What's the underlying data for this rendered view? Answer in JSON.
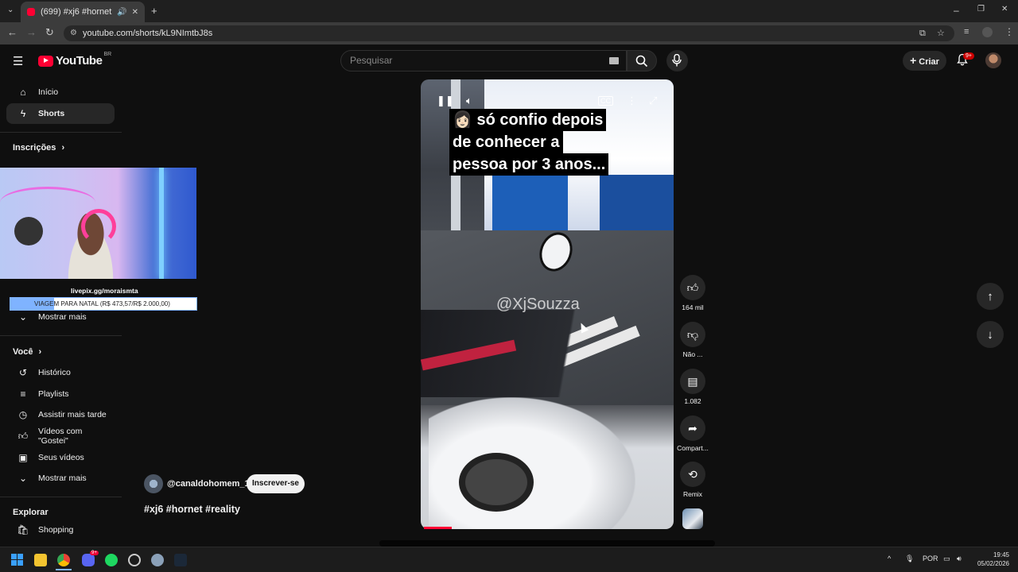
{
  "browser": {
    "tab_title": "(699) #xj6 #hornet #reality",
    "url": "youtube.com/shorts/kL9NImtbJ8s",
    "new_tab": "+",
    "minimize": "–",
    "maximize": "❐",
    "close": "✕"
  },
  "header": {
    "logo_text": "YouTube",
    "country": "BR",
    "search_placeholder": "Pesquisar",
    "create_label": "Criar",
    "notif_count": "9+"
  },
  "sidebar": {
    "main": [
      {
        "label": "Início",
        "icon": "home-icon"
      },
      {
        "label": "Shorts",
        "icon": "shorts-icon"
      }
    ],
    "subs_title": "Inscrições",
    "show_more_1": "Mostrar mais",
    "you_title": "Você",
    "you_items": [
      {
        "label": "Histórico",
        "icon": "history-icon"
      },
      {
        "label": "Playlists",
        "icon": "playlist-icon"
      },
      {
        "label": "Assistir mais tarde",
        "icon": "clock-icon"
      },
      {
        "label": "Vídeos com \"Gostei\"",
        "icon": "like-icon"
      },
      {
        "label": "Seus vídeos",
        "icon": "video-icon"
      }
    ],
    "show_more_2": "Mostrar mais",
    "explore_title": "Explorar",
    "explore_items": [
      {
        "label": "Shopping",
        "icon": "bag-icon"
      }
    ]
  },
  "overlay": {
    "livepix": "livepix.gg/moraismta",
    "goal_text": "VIAGEM PARA NATAL (R$ 473,57/R$ 2.000,00)",
    "goal_progress": 0.2368
  },
  "short": {
    "caption_lines": [
      "só confio depois",
      "de conhecer a",
      "pessoa por 3 anos..."
    ],
    "caption_emoji": "👩🏻",
    "watermark": "@XjSouzza",
    "progress": 0.11,
    "channel": "@canaldohomem_1",
    "subscribe_label": "Inscrever-se",
    "hashtags": "#xj6 #hornet #reality"
  },
  "actions": {
    "likes": "164 mil",
    "dislike": "Não ...",
    "comments": "1.082",
    "share": "Compart...",
    "remix": "Remix"
  },
  "taskbar": {
    "lang": "POR",
    "time": "19:45",
    "date": "05/02/2026",
    "discord_badge": "9+"
  }
}
